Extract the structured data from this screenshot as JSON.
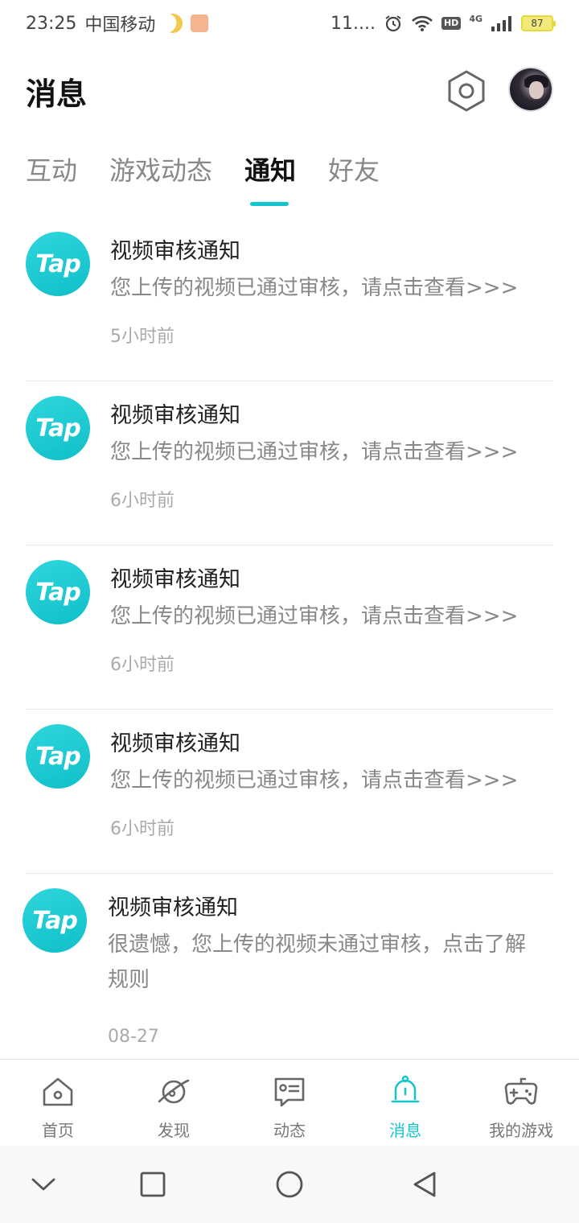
{
  "status_bar": {
    "time": "23:25",
    "carrier": "中国移动",
    "network_speed": "11....",
    "hd": "HD",
    "net_type": "4G",
    "battery": "87"
  },
  "header": {
    "title": "消息"
  },
  "tabs": [
    {
      "label": "互动"
    },
    {
      "label": "游戏动态"
    },
    {
      "label": "通知"
    },
    {
      "label": "好友"
    }
  ],
  "active_tab": "通知",
  "notifications": [
    {
      "logo": "Tap",
      "title": "视频审核通知",
      "body": "您上传的视频已通过审核，请点击查看>>>",
      "time": "5小时前"
    },
    {
      "logo": "Tap",
      "title": "视频审核通知",
      "body": "您上传的视频已通过审核，请点击查看>>>",
      "time": "6小时前"
    },
    {
      "logo": "Tap",
      "title": "视频审核通知",
      "body": "您上传的视频已通过审核，请点击查看>>>",
      "time": "6小时前"
    },
    {
      "logo": "Tap",
      "title": "视频审核通知",
      "body": "您上传的视频已通过审核，请点击查看>>>",
      "time": "6小时前"
    },
    {
      "logo": "Tap",
      "title": "视频审核通知",
      "body": "很遗憾，您上传的视频未通过审核，点击了解规则",
      "time": "08-27"
    }
  ],
  "bottom_nav": [
    {
      "label": "首页",
      "icon": "home-icon"
    },
    {
      "label": "发现",
      "icon": "planet-icon"
    },
    {
      "label": "动态",
      "icon": "chat-card-icon"
    },
    {
      "label": "消息",
      "icon": "bell-icon"
    },
    {
      "label": "我的游戏",
      "icon": "gamepad-icon"
    }
  ],
  "colors": {
    "accent": "#15c5ce",
    "tap_brand": "#1cc8d2"
  }
}
